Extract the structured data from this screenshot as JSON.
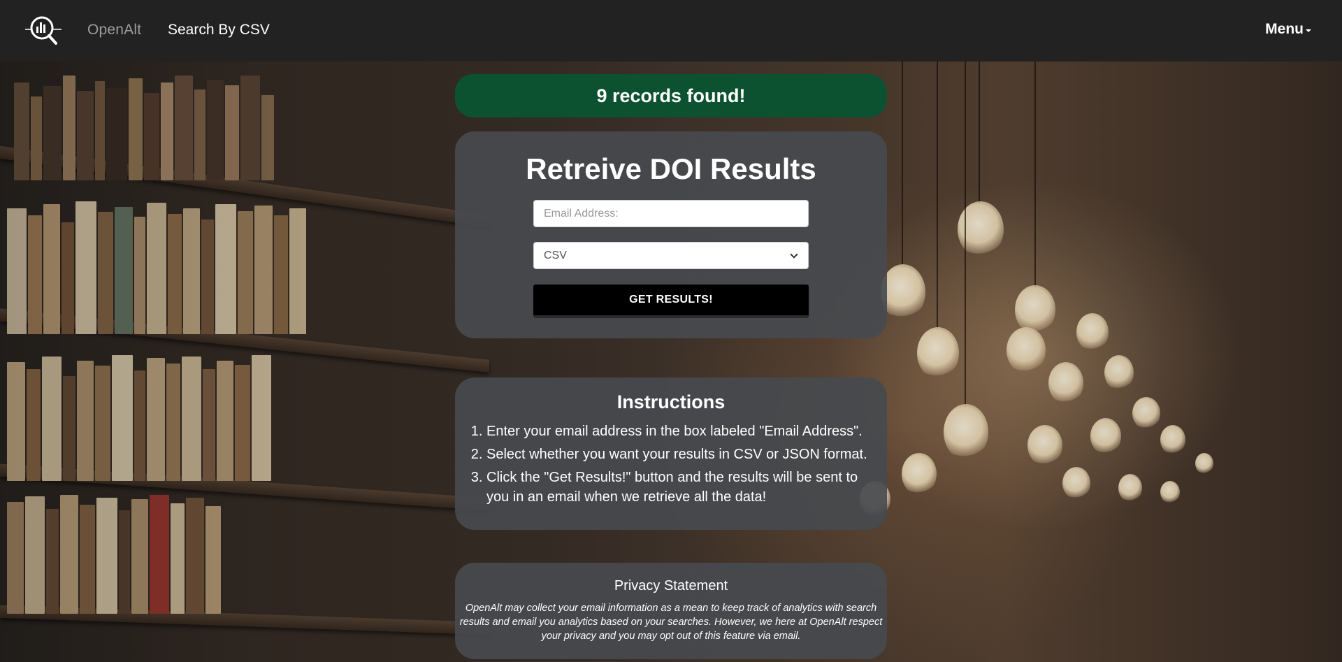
{
  "navbar": {
    "brand": "OpenAlt",
    "search_link": "Search By CSV",
    "menu_label": "Menu"
  },
  "alert": {
    "message": "9 records found!",
    "color": "#0c5230"
  },
  "form": {
    "title": "Retreive DOI Results",
    "email_placeholder": "Email Address:",
    "format_selected": "CSV",
    "submit_label": "GET RESULTS!"
  },
  "instructions": {
    "title": "Instructions",
    "steps": [
      "Enter your email address in the box labeled \"Email Address\".",
      "Select whether you want your results in CSV or JSON format.",
      "Click the \"Get Results!\" button and the results will be sent to you in an email when we retrieve all the data!"
    ]
  },
  "privacy": {
    "title": "Privacy Statement",
    "text": "OpenAlt may collect your email information as a mean to keep track of analytics with search results and email you analytics based on your searches. However, we here at OpenAlt respect your privacy and you may opt out of this feature via email."
  },
  "icons": {
    "logo": "magnifier-chart-logo-icon",
    "menu_caret": "caret-down-icon",
    "select_chevron": "chevron-down-icon"
  }
}
